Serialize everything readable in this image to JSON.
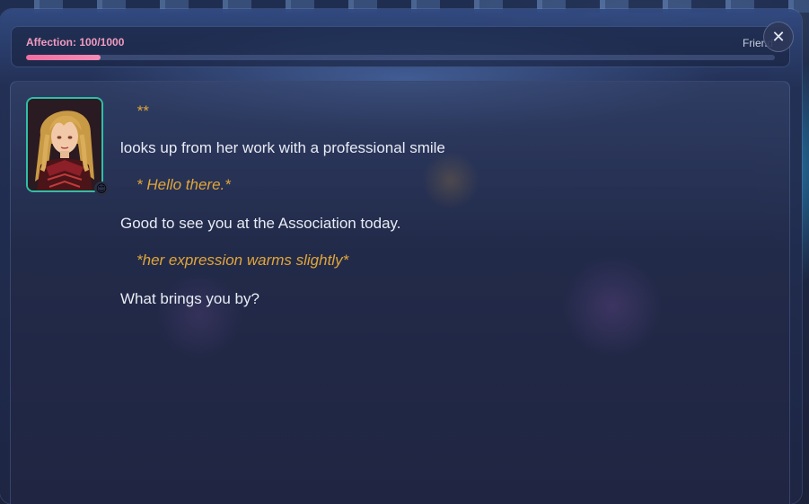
{
  "affection": {
    "label": "Affection: 100/1000",
    "relation": "Friend",
    "progress_fraction": 0.1,
    "fill_color": "#f06ea0"
  },
  "close_button": {
    "icon": "close-icon",
    "glyph": "✕"
  },
  "character": {
    "avatar_icon": "character-portrait",
    "mood_emoji": "😊",
    "frame_color": "#2fbfa5"
  },
  "message": {
    "lines": [
      {
        "kind": "action",
        "text": "**"
      },
      {
        "kind": "speech",
        "text": "looks up from her work with a professional smile"
      },
      {
        "kind": "action",
        "text": "* Hello there.*"
      },
      {
        "kind": "speech",
        "text": "Good to see you at the Association today."
      },
      {
        "kind": "action",
        "text": "*her expression warms slightly*"
      },
      {
        "kind": "speech",
        "text": "What brings you by?"
      }
    ]
  },
  "colors": {
    "action_text": "#e0a63a",
    "speech_text": "#e8ebf4",
    "affection_label": "#f29bc0"
  }
}
